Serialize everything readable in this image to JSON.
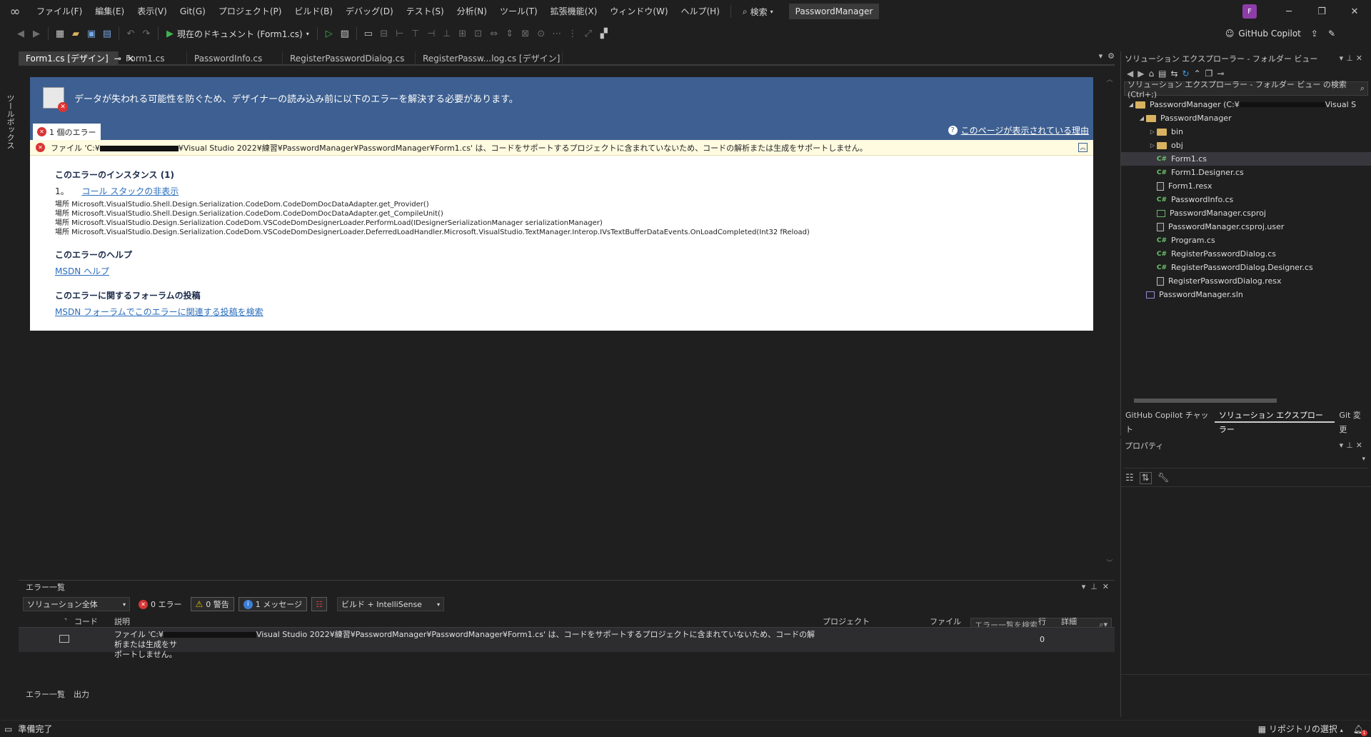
{
  "titlebar": {
    "menu": [
      "ファイル(F)",
      "編集(E)",
      "表示(V)",
      "Git(G)",
      "プロジェクト(P)",
      "ビルド(B)",
      "デバッグ(D)",
      "テスト(S)",
      "分析(N)",
      "ツール(T)",
      "拡張機能(X)",
      "ウィンドウ(W)",
      "ヘルプ(H)"
    ],
    "search_label": "検索",
    "solution_name": "PasswordManager",
    "profile_initial": "F"
  },
  "toolbar": {
    "start_label": "現在のドキュメント (Form1.cs)",
    "copilot_label": "GitHub Copilot"
  },
  "toolbox": {
    "label": "ツールボックス"
  },
  "doc_tabs": [
    {
      "label": "Form1.cs [デザイン]",
      "width": 140
    },
    {
      "label": "Form1.cs",
      "width": 96
    },
    {
      "label": "PasswordInfo.cs",
      "width": 134
    },
    {
      "label": "RegisterPasswordDialog.cs",
      "width": 186
    },
    {
      "label": "RegisterPassw...log.cs [デザイン]",
      "width": 206
    }
  ],
  "error_page": {
    "banner": "データが失われる可能性を防ぐため、デザイナーの読み込み前に以下のエラーを解決する必要があります。",
    "error_count": "1 個のエラー",
    "why_link": "このページが表示されている理由",
    "message_prefix": "ファイル 'C:¥",
    "message_suffix": "¥Visual Studio 2022¥練習¥PasswordManager¥PasswordManager¥Form1.cs' は、コードをサポートするプロジェクトに含まれていないため、コードの解析または生成をサポートしません。",
    "instances_title": "このエラーのインスタンス (1)",
    "instance_number": "1。",
    "callstack_link": "コール スタックの非表示",
    "stack": [
      "場所 Microsoft.VisualStudio.Shell.Design.Serialization.CodeDom.CodeDomDocDataAdapter.get_Provider()",
      "場所 Microsoft.VisualStudio.Shell.Design.Serialization.CodeDom.CodeDomDocDataAdapter.get_CompileUnit()",
      "場所 Microsoft.VisualStudio.Design.Serialization.CodeDom.VSCodeDomDesignerLoader.PerformLoad(IDesignerSerializationManager serializationManager)",
      "場所 Microsoft.VisualStudio.Design.Serialization.CodeDom.VSCodeDomDesignerLoader.DeferredLoadHandler.Microsoft.VisualStudio.TextManager.Interop.IVsTextBufferDataEvents.OnLoadCompleted(Int32 fReload)"
    ],
    "help_title": "このエラーのヘルプ",
    "help_link": "MSDN ヘルプ",
    "forum_title": "このエラーに関するフォーラムの投稿",
    "forum_link": "MSDN フォーラムでこのエラーに関連する投稿を検索"
  },
  "error_list": {
    "title": "エラー一覧",
    "scope": "ソリューション全体",
    "errors": "0 エラー",
    "warnings": "0 警告",
    "messages": "1 メッセージ",
    "build_filter": "ビルド + IntelliSense",
    "search_placeholder": "エラー一覧を検索",
    "columns": {
      "code": "コード",
      "description": "説明",
      "project": "プロジェクト",
      "file": "ファイル",
      "line": "行",
      "detail": "詳細"
    },
    "row": {
      "desc_line1_prefix": "ファイル 'C:¥",
      "desc_line1_suffix": "Visual Studio 2022¥練習¥PasswordManager¥PasswordManager¥Form1.cs' は、コードをサポートするプロジェクトに含まれていないため、コードの解析または生成をサ",
      "desc_line2": "ポートしません。",
      "line": "0"
    },
    "footer_tabs": [
      "エラー一覧",
      "出力"
    ]
  },
  "solution_explorer": {
    "title": "ソリューション エクスプローラー - フォルダー ビュー",
    "search": "ソリューション エクスプローラー - フォルダー ビュー の検索 (Ctrl+;)",
    "tree": [
      {
        "label": "PasswordManager (C:¥",
        "suffix": "Visual S",
        "indent": 0,
        "arrow": "◢",
        "icon": "folder"
      },
      {
        "label": "PasswordManager",
        "indent": 1,
        "arrow": "◢",
        "icon": "folder"
      },
      {
        "label": "bin",
        "indent": 2,
        "arrow": "▷",
        "icon": "folder"
      },
      {
        "label": "obj",
        "indent": 2,
        "arrow": "▷",
        "icon": "folder"
      },
      {
        "label": "Form1.cs",
        "indent": 2,
        "arrow": "",
        "icon": "cs",
        "selected": true
      },
      {
        "label": "Form1.Designer.cs",
        "indent": 2,
        "arrow": "",
        "icon": "cs"
      },
      {
        "label": "Form1.resx",
        "indent": 2,
        "arrow": "",
        "icon": "file"
      },
      {
        "label": "PasswordInfo.cs",
        "indent": 2,
        "arrow": "",
        "icon": "cs"
      },
      {
        "label": "PasswordManager.csproj",
        "indent": 2,
        "arrow": "",
        "icon": "proj"
      },
      {
        "label": "PasswordManager.csproj.user",
        "indent": 2,
        "arrow": "",
        "icon": "file"
      },
      {
        "label": "Program.cs",
        "indent": 2,
        "arrow": "",
        "icon": "cs"
      },
      {
        "label": "RegisterPasswordDialog.cs",
        "indent": 2,
        "arrow": "",
        "icon": "cs"
      },
      {
        "label": "RegisterPasswordDialog.Designer.cs",
        "indent": 2,
        "arrow": "",
        "icon": "cs"
      },
      {
        "label": "RegisterPasswordDialog.resx",
        "indent": 2,
        "arrow": "",
        "icon": "file"
      },
      {
        "label": "PasswordManager.sln",
        "indent": 1,
        "arrow": "",
        "icon": "sln"
      }
    ],
    "bottom_tabs": [
      "GitHub Copilot チャット",
      "ソリューション エクスプローラー",
      "Git 変更"
    ]
  },
  "properties": {
    "title": "プロパティ"
  },
  "statusbar": {
    "ready": "準備完了",
    "repo": "リポジトリの選択"
  }
}
